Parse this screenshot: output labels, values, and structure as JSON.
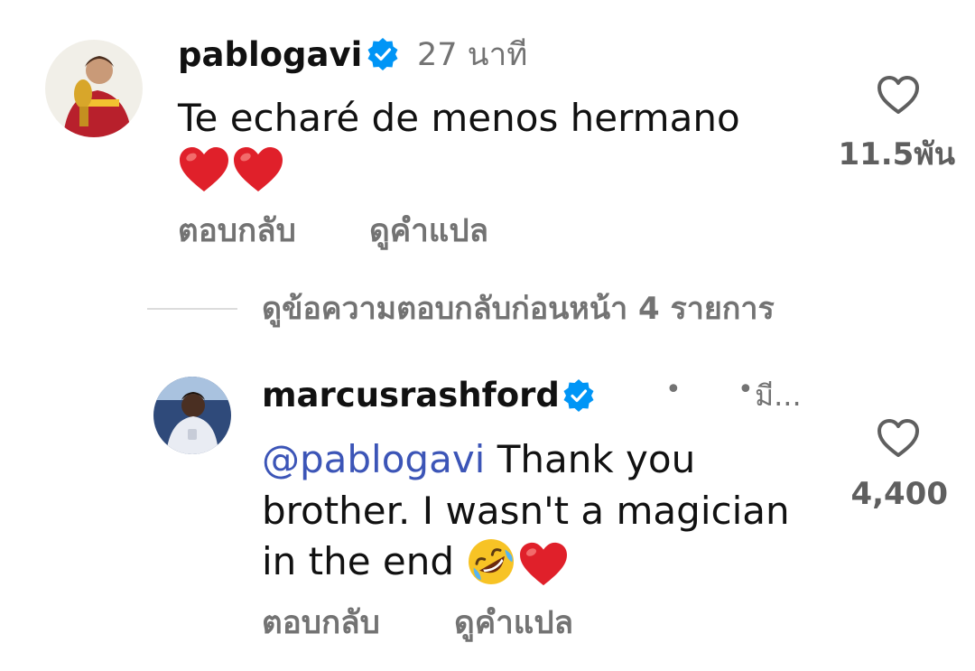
{
  "comments": [
    {
      "username": "pablogavi",
      "verified": true,
      "timestamp": "27 นาที",
      "text": "Te echaré de menos hermano",
      "emoji_line": [
        "red-heart",
        "red-heart"
      ],
      "reply_label": "ตอบกลับ",
      "translate_label": "ดูคำแปล",
      "like_count": "11.5พัน"
    },
    {
      "username": "marcusrashford",
      "verified": true,
      "timestamp": "มี...",
      "mention": "@pablogavi",
      "text_line1": " Thank you",
      "text_line2": "brother. I wasn't a magician",
      "text_line3": "in the end ",
      "emojis": [
        "rolling-on-floor-laughing",
        "red-heart"
      ],
      "reply_label": "ตอบกลับ",
      "translate_label": "ดูคำแปล",
      "like_count": "4,400"
    }
  ],
  "view_previous_replies": "ดูข้อความตอบกลับก่อนหน้า 4 รายการ",
  "colors": {
    "verified_blue": "#0095f6",
    "mention_blue": "#3c55b7",
    "secondary_text": "#737373"
  }
}
